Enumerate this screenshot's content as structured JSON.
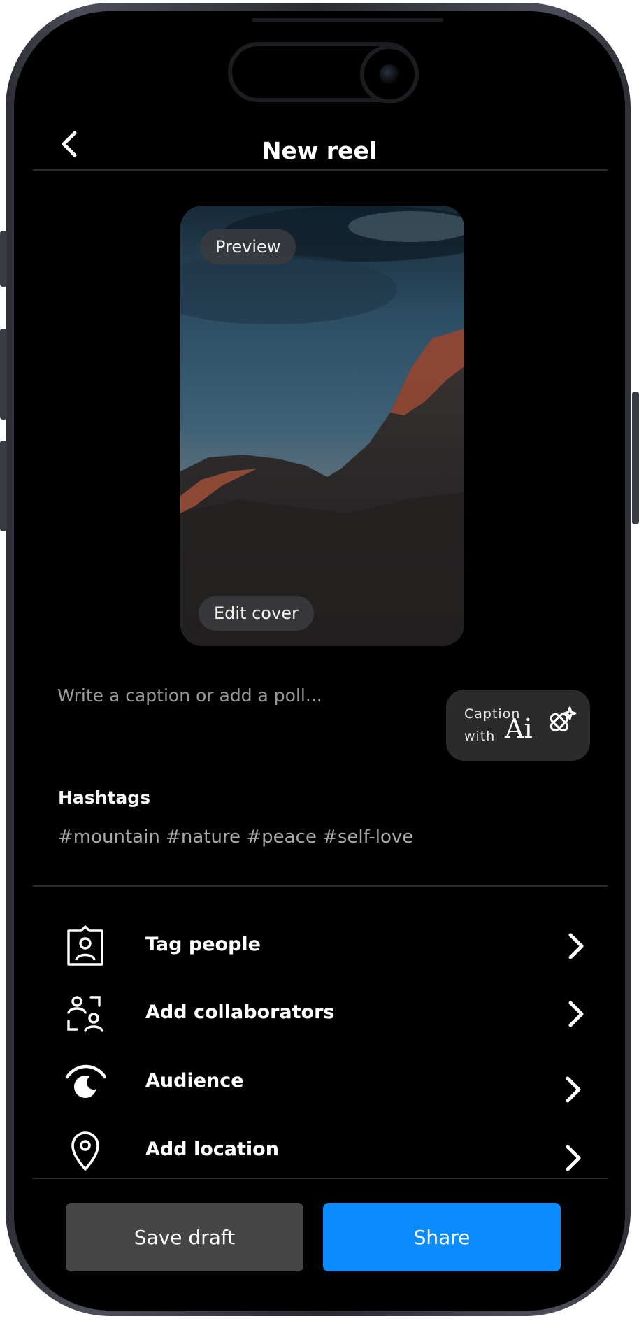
{
  "header": {
    "title": "New reel"
  },
  "preview": {
    "preview_label": "Preview",
    "edit_cover_label": "Edit cover"
  },
  "caption": {
    "placeholder": "Write a caption or add a poll...",
    "ai_button": {
      "line1": "Caption",
      "line2": "with",
      "ai": "Ai"
    }
  },
  "hashtags": {
    "label": "Hashtags",
    "value": "#mountain #nature #peace #self-love"
  },
  "menu": {
    "items": [
      {
        "label": "Tag people",
        "icon": "tag-people-icon"
      },
      {
        "label": "Add collaborators",
        "icon": "collaborators-icon"
      },
      {
        "label": "Audience",
        "icon": "audience-icon"
      },
      {
        "label": "Add location",
        "icon": "location-pin-icon"
      }
    ]
  },
  "actions": {
    "save_draft": "Save draft",
    "share": "Share"
  },
  "colors": {
    "accent": "#0a8cff",
    "background": "#000000",
    "secondary_button": "#454545"
  }
}
